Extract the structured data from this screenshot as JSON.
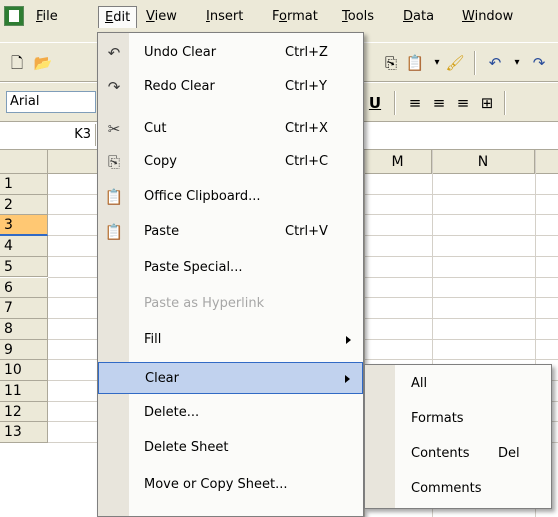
{
  "menubar": {
    "items": [
      "File",
      "Edit",
      "View",
      "Insert",
      "Format",
      "Tools",
      "Data",
      "Window"
    ],
    "active": "Edit"
  },
  "formatting": {
    "font": "Arial"
  },
  "formula_bar": {
    "name_box": "K3"
  },
  "columns": [
    "M",
    "N"
  ],
  "rows": [
    "1",
    "2",
    "3",
    "4",
    "5",
    "6",
    "7",
    "8",
    "9",
    "10",
    "11",
    "12",
    "13"
  ],
  "selected_row": "3",
  "edit_menu": [
    {
      "label": "Undo Clear",
      "shortcut": "Ctrl+Z",
      "icon": "undo-icon"
    },
    {
      "label": "Redo Clear",
      "shortcut": "Ctrl+Y",
      "icon": "redo-icon"
    },
    {
      "label": "Cut",
      "shortcut": "Ctrl+X",
      "icon": "scissors-icon"
    },
    {
      "label": "Copy",
      "shortcut": "Ctrl+C",
      "icon": "copy-icon"
    },
    {
      "label": "Office Clipboard...",
      "shortcut": "",
      "icon": "clipboard-icon"
    },
    {
      "label": "Paste",
      "shortcut": "Ctrl+V",
      "icon": "paste-icon"
    },
    {
      "label": "Paste Special...",
      "shortcut": ""
    },
    {
      "label": "Paste as Hyperlink",
      "shortcut": "",
      "disabled": true
    },
    {
      "label": "Fill",
      "shortcut": "",
      "submenu": true
    },
    {
      "label": "Clear",
      "shortcut": "",
      "submenu": true,
      "highlighted": true
    },
    {
      "label": "Delete...",
      "shortcut": ""
    },
    {
      "label": "Delete Sheet",
      "shortcut": ""
    },
    {
      "label": "Move or Copy Sheet...",
      "shortcut": ""
    }
  ],
  "clear_submenu": [
    {
      "label": "All",
      "shortcut": ""
    },
    {
      "label": "Formats",
      "shortcut": ""
    },
    {
      "label": "Contents",
      "shortcut": "Del"
    },
    {
      "label": "Comments",
      "shortcut": ""
    }
  ]
}
